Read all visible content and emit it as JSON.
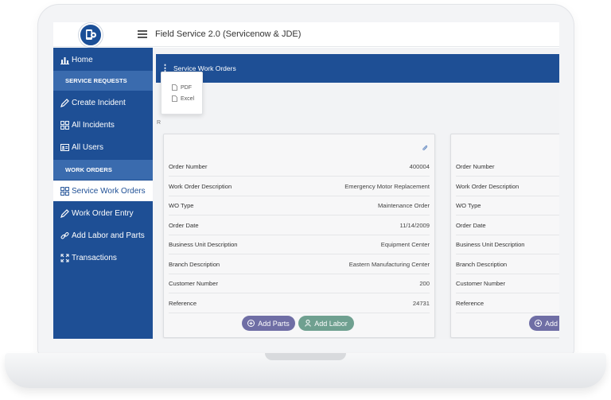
{
  "app": {
    "title": "Field Service 2.0 (Servicenow & JDE)"
  },
  "sidebar": {
    "home": "Home",
    "section_requests": "SERVICE REQUESTS",
    "create_incident": "Create Incident",
    "all_incidents": "All Incidents",
    "all_users": "All Users",
    "section_orders": "WORK ORDERS",
    "service_work_orders": "Service Work Orders",
    "work_order_entry": "Work Order Entry",
    "add_labor_parts": "Add Labor and Parts",
    "transactions": "Transactions"
  },
  "page": {
    "header": "Service Work Orders",
    "export_options": [
      "PDF",
      "Excel"
    ],
    "stray_text": "R"
  },
  "card": {
    "rows": [
      {
        "label": "Order Number",
        "value": "400004"
      },
      {
        "label": "Work Order Description",
        "value": "Emergency Motor Replacement"
      },
      {
        "label": "WO Type",
        "value": "Maintenance Order"
      },
      {
        "label": "Order Date",
        "value": "11/14/2009"
      },
      {
        "label": "Business Unit Description",
        "value": "Equipment Center"
      },
      {
        "label": "Branch Description",
        "value": "Eastern Manufacturing Center"
      },
      {
        "label": "Customer Number",
        "value": "200"
      },
      {
        "label": "Reference",
        "value": "24731"
      }
    ],
    "add_parts": "Add Parts",
    "add_labor": "Add Labor",
    "add_partial": "Add"
  },
  "colors": {
    "primary": "#1e4f95",
    "section": "#3a6bae",
    "add_parts_button": "#6f6ea5",
    "add_labor_button": "#6fa090"
  },
  "icons": {
    "home": "bar-chart-icon",
    "create_incident": "pencil-icon",
    "all_incidents": "grid-icon",
    "all_users": "id-card-icon",
    "service_work_orders": "grid-icon",
    "work_order_entry": "pencil-icon",
    "add_labor_parts": "link-icon",
    "transactions": "expand-arrows-icon"
  }
}
